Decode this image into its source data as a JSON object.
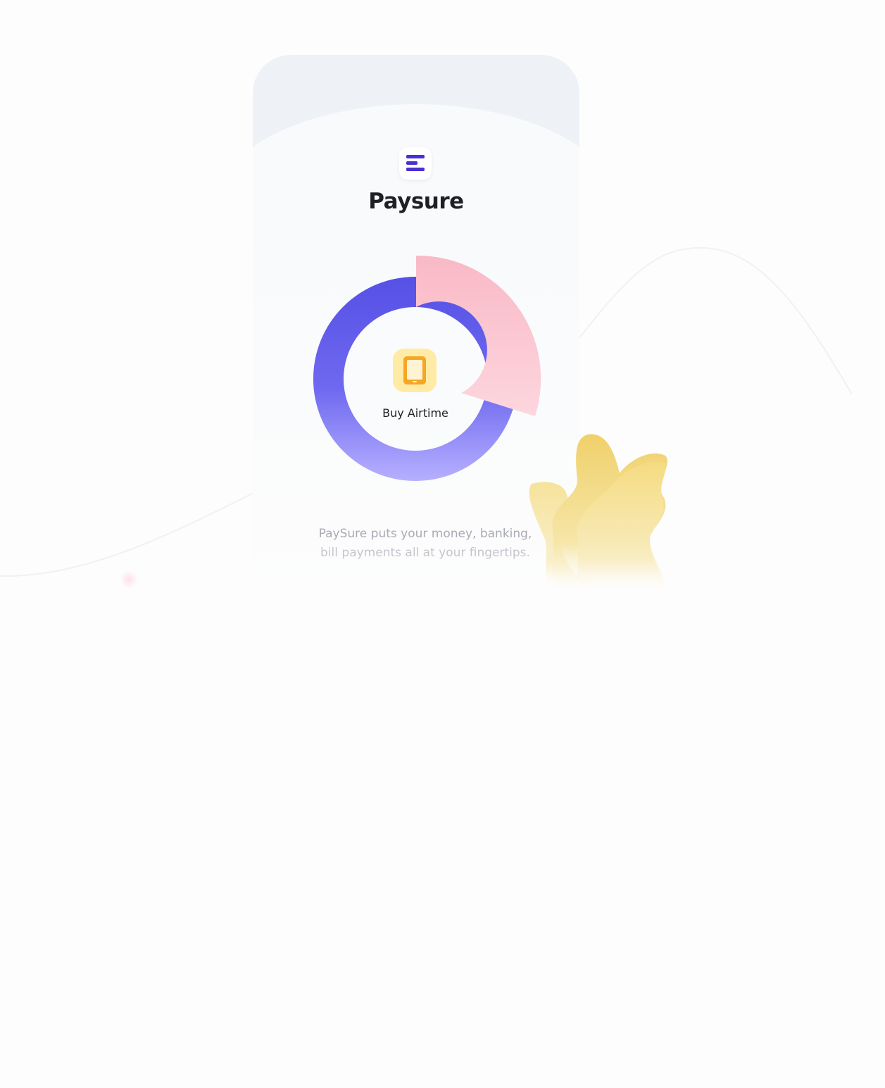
{
  "brand": {
    "name": "Paysure",
    "logo_icon": "paysure-logo-icon",
    "logo_color": "#4a2fd6"
  },
  "feature": {
    "label": "Buy Airtime",
    "icon": "smartphone-icon",
    "icon_bg": "#ffeba6",
    "icon_color": "#f5a623"
  },
  "tagline": {
    "line1": "PaySure puts your money, banking,",
    "line2": "bill payments all at your fingertips."
  },
  "colors": {
    "donut_primary": "#5a54e8",
    "donut_secondary": "#b3acff",
    "pink_segment": "#f9bfcb",
    "blob_yellow": "#f2d56a"
  }
}
